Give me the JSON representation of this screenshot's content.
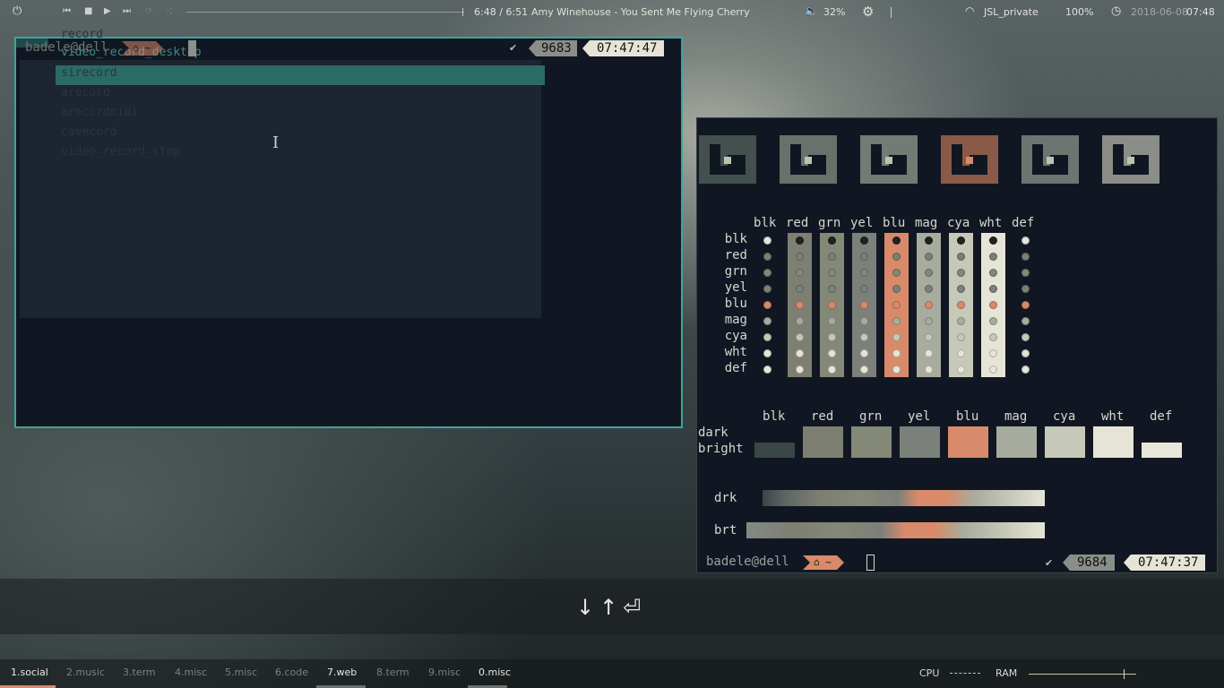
{
  "topbar": {
    "power_icon": "power-icon",
    "media": {
      "prev": "⏮",
      "stop": "■",
      "play": "▶",
      "next": "⏭",
      "repeat": "⟳",
      "shuffle": "⤮",
      "progress": 0.995,
      "time": "6:48 / 6:51",
      "track": "Amy Winehouse - You Sent Me Flying  Cherry"
    },
    "volume_icon": "speaker-icon",
    "volume": "32%",
    "settings_icon": "gear-icon",
    "wifi_icon": "wifi-icon",
    "network": "JSL_private",
    "battery": "100%",
    "clock_icon": "clock-icon",
    "date": "2018-06-08",
    "time": "07:48"
  },
  "term1": {
    "user": "badele@dell",
    "path": "⌂ ~",
    "ghost_lines": [
      "record",
      "video_record_desktop",
      "sirecord",
      "arecord",
      "arecordmidi",
      "cavecord",
      "video_record_stop"
    ],
    "status_check": "✔",
    "cmd_num": "9683",
    "clock": "07:47:47",
    "border_color": "#3aa69a"
  },
  "term2": {
    "col_headers": [
      "blk",
      "red",
      "grn",
      "yel",
      "blu",
      "mag",
      "cya",
      "wht",
      "def"
    ],
    "row_labels": [
      "blk",
      "red",
      "grn",
      "yel",
      "blu",
      "mag",
      "cya",
      "wht",
      "def"
    ],
    "swatch_labels": [
      "dark",
      "bright"
    ],
    "drk_label": "drk",
    "brt_label": "brt",
    "colors": {
      "blk": "#3b4646",
      "red": "#7c7f72",
      "grn": "#838877",
      "yel": "#7c807a",
      "blu": "#d88a6a",
      "mag": "#a8ac9e",
      "cya": "#c7c9b8",
      "wht": "#e6e4d6",
      "def": "#e8e6d8"
    },
    "user": "badele@dell",
    "path": "⌂ ~",
    "status_check": "✔",
    "cmd_num": "9684",
    "clock": "07:47:37"
  },
  "key_hint": "↓↑⏎",
  "workspaces": [
    {
      "label": "1.social",
      "active": true,
      "underline": "#d88a6a"
    },
    {
      "label": "2.music",
      "active": false
    },
    {
      "label": "3.term",
      "active": false
    },
    {
      "label": "4.misc",
      "active": false
    },
    {
      "label": "5.misc",
      "active": false
    },
    {
      "label": "6.code",
      "active": false
    },
    {
      "label": "7.web",
      "active": true,
      "underline": "#6a7270"
    },
    {
      "label": "8.term",
      "active": false
    },
    {
      "label": "9.misc",
      "active": false
    },
    {
      "label": "0.misc",
      "active": true,
      "underline": "#6a7270"
    }
  ],
  "sysmon": {
    "cpu_label": "CPU",
    "ram_label": "RAM",
    "ram_level": 0.88
  }
}
